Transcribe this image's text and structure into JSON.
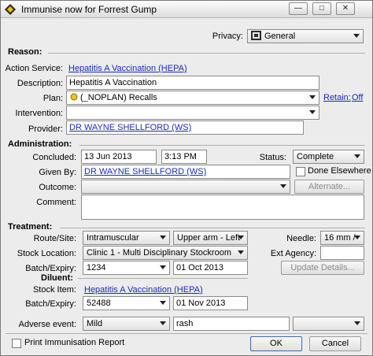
{
  "window": {
    "title": "Immunise now for Forrest Gump"
  },
  "privacy": {
    "label": "Privacy:",
    "value": "General"
  },
  "sections": {
    "reason": "Reason:",
    "administration": "Administration:",
    "treatment": "Treatment:",
    "diluent": "Diluent:"
  },
  "reason": {
    "action_service": {
      "label": "Action Service:",
      "value": "Hepatitis A Vaccination (HEPA)"
    },
    "description": {
      "label": "Description:",
      "value": "Hepatitis A Vaccination"
    },
    "plan": {
      "label": "Plan:",
      "value": "(_NOPLAN) Recalls",
      "retain_label": "Retain:",
      "retain_value": "Off"
    },
    "intervention": {
      "label": "Intervention:",
      "value": ""
    },
    "provider": {
      "label": "Provider:",
      "value": "DR WAYNE SHELLFORD (WS)"
    }
  },
  "administration": {
    "concluded": {
      "label": "Concluded:",
      "date": "13 Jun 2013",
      "time": "3:13 PM"
    },
    "status": {
      "label": "Status:",
      "value": "Complete"
    },
    "given_by": {
      "label": "Given By:",
      "value": "DR WAYNE SHELLFORD (WS)"
    },
    "done_elsewhere": {
      "label": "Done Elsewhere",
      "checked": false
    },
    "outcome": {
      "label": "Outcome:",
      "value": ""
    },
    "alternate_button": "Alternate...",
    "comment": {
      "label": "Comment:",
      "value": ""
    }
  },
  "treatment": {
    "route_site": {
      "label": "Route/Site:",
      "route": "Intramuscular",
      "site": "Upper arm - Left"
    },
    "needle": {
      "label": "Needle:",
      "value": "16 mm /"
    },
    "stock_location": {
      "label": "Stock Location:",
      "value": "Clinic 1 - Multi Disciplinary Stockroom"
    },
    "ext_agency": {
      "label": "Ext Agency:",
      "value": ""
    },
    "batch_expiry": {
      "label": "Batch/Expiry:",
      "batch": "1234",
      "expiry": "01 Oct 2013"
    },
    "update_details_button": "Update Details..."
  },
  "diluent": {
    "stock_item": {
      "label": "Stock Item:",
      "value": "Hepatitis A Vaccination (HEPA)"
    },
    "batch_expiry": {
      "label": "Batch/Expiry:",
      "batch": "52488",
      "expiry": "01 Nov 2013"
    }
  },
  "adverse_event": {
    "label": "Adverse event:",
    "severity": "Mild",
    "text": "rash",
    "extra": ""
  },
  "footer": {
    "print_label": "Print Immunisation Report",
    "print_checked": false,
    "ok_button": "OK",
    "cancel_button": "Cancel"
  }
}
